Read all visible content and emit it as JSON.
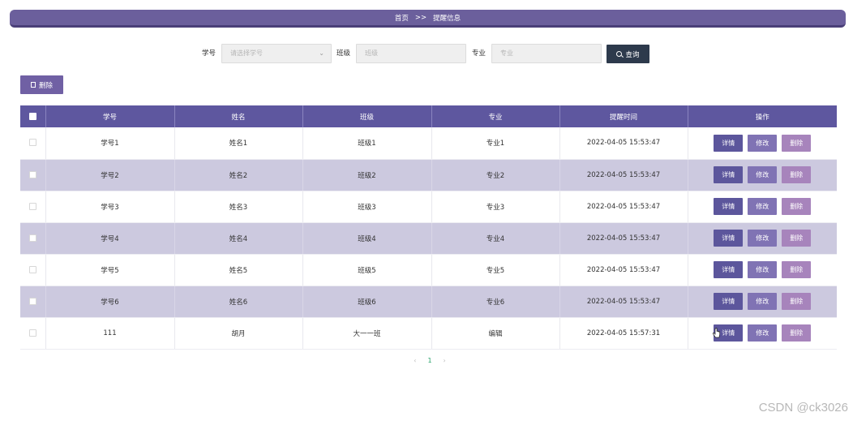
{
  "breadcrumb": {
    "home": "首页",
    "separator": ">>",
    "current": "提醒信息"
  },
  "search": {
    "student_id_label": "学号",
    "student_id_placeholder": "请选择学号",
    "class_label": "班级",
    "class_placeholder": "班级",
    "major_label": "专业",
    "major_placeholder": "专业",
    "query_button": "查询"
  },
  "toolbar": {
    "delete_label": "删除"
  },
  "table": {
    "columns": [
      "学号",
      "姓名",
      "班级",
      "专业",
      "提醒时间",
      "操作"
    ],
    "rows": [
      [
        "学号1",
        "姓名1",
        "班级1",
        "专业1",
        "2022-04-05 15:53:47"
      ],
      [
        "学号2",
        "姓名2",
        "班级2",
        "专业2",
        "2022-04-05 15:53:47"
      ],
      [
        "学号3",
        "姓名3",
        "班级3",
        "专业3",
        "2022-04-05 15:53:47"
      ],
      [
        "学号4",
        "姓名4",
        "班级4",
        "专业4",
        "2022-04-05 15:53:47"
      ],
      [
        "学号5",
        "姓名5",
        "班级5",
        "专业5",
        "2022-04-05 15:53:47"
      ],
      [
        "学号6",
        "姓名6",
        "班级6",
        "专业6",
        "2022-04-05 15:53:47"
      ],
      [
        "111",
        "胡月",
        "大一一班",
        "编辑",
        "2022-04-05 15:57:31"
      ]
    ],
    "actions": {
      "detail": "详情",
      "edit": "修改",
      "delete": "删除"
    }
  },
  "pagination": {
    "prev": "‹",
    "current": "1",
    "next": "›"
  },
  "watermark": "CSDN @ck3026",
  "colors": {
    "header": "#6b5f9c",
    "table_header": "#5e579f",
    "alt_row": "#ccc9df",
    "query_button": "#2d3a4c"
  }
}
